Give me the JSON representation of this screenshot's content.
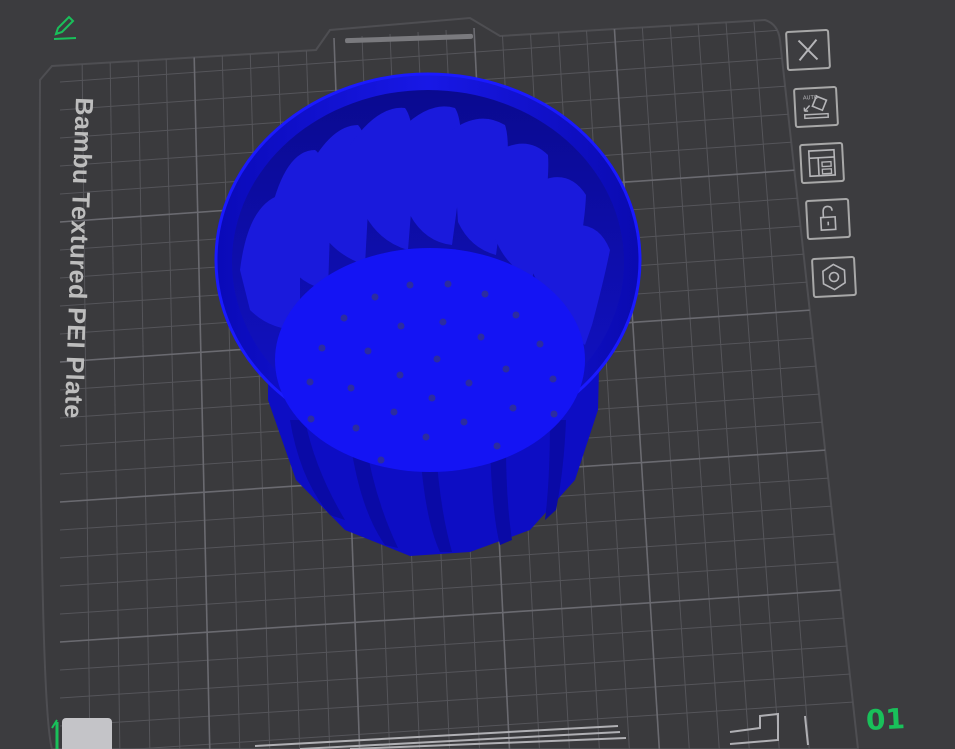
{
  "plate": {
    "label": "Bambu Textured PEI Plate",
    "number": "01"
  },
  "model": {
    "color": "#1010f0"
  },
  "colors": {
    "background": "#3c3c3f",
    "plate": "#3a3a3d",
    "grid": "#58585c",
    "accent_green": "#19c05a",
    "icon_stroke": "#a8a8a8"
  },
  "toolbar": {
    "buttons": [
      "close-icon",
      "auto-orient-icon",
      "arrange-icon",
      "lock-icon",
      "settings-hex-icon"
    ]
  }
}
